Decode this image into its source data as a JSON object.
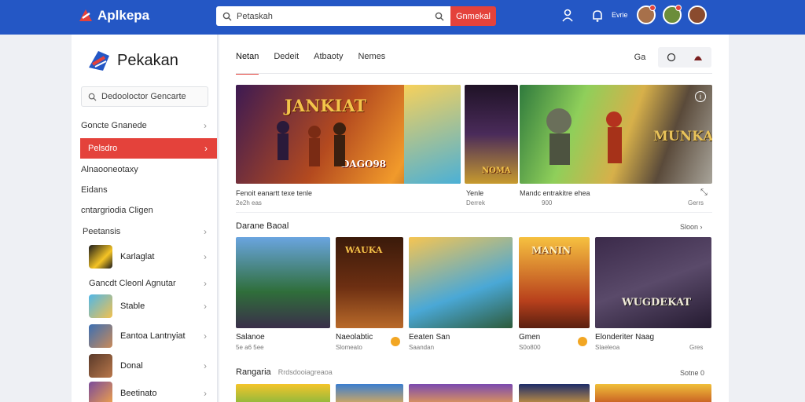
{
  "app": {
    "brand": "Aplkepa",
    "brand_color": "#2457c5",
    "accent_color": "#e4423b"
  },
  "header": {
    "search_placeholder": "Petaskah",
    "search_button": "Gnmekal",
    "label": "Evrie",
    "icons": [
      "user-icon",
      "notification-icon"
    ]
  },
  "sidebar": {
    "logo_text": "Pekakan",
    "search_placeholder": "Dedooloctor Gencarte",
    "items": [
      {
        "label": "Goncte Gnanede",
        "active": false
      },
      {
        "label": "Pelsdro",
        "active": true
      },
      {
        "label": "Alnaooneotaxy",
        "active": false
      },
      {
        "label": "Eidans",
        "active": false
      },
      {
        "label": "cntargriodia Cligen",
        "active": false
      },
      {
        "label": "Peetansis",
        "active": false
      }
    ],
    "games": [
      {
        "label": "Karlaglat"
      },
      {
        "label": "Stable"
      },
      {
        "label": "Eantoa Lantnyiat"
      },
      {
        "label": "Donal"
      },
      {
        "label": "Beetinato"
      }
    ],
    "group_label": "Gancdt Cleonl Agnutar"
  },
  "main": {
    "tabs": [
      "Netan",
      "Dedeit",
      "Atbaoty",
      "Nemes"
    ],
    "tool_label": "Ga",
    "banners": [
      {
        "art_title": "JANKIAT",
        "caption": "Fenoit eanartt texe tenle",
        "sub": "2e2h eas",
        "sub2": "",
        "badge": "DAGO98"
      },
      {
        "art_title": "NOMA",
        "caption": "Yenle",
        "sub": "Derrek",
        "sub2": "",
        "badge": ""
      },
      {
        "art_title": "MUNKA",
        "caption": "Mandc entrakitre ehea",
        "sub": "900",
        "sub2": "Gerrs",
        "badge": ""
      }
    ],
    "section1": {
      "title": "Darane Baoal",
      "more": "Sloon"
    },
    "cards": [
      {
        "title": "Salanoe",
        "sub": "5e a6 5ee"
      },
      {
        "title": "Naeolabtic",
        "sub": "Slomeato"
      },
      {
        "title": "Eeaten San",
        "sub": "Saandan"
      },
      {
        "title": "Gmen",
        "sub": "S0o800"
      },
      {
        "title": "Elonderiter Naag",
        "sub": "Slaeleoa"
      }
    ],
    "card_tail": "Gres",
    "card_art": [
      "WAUKA",
      "MANIN",
      "WUGDEKAT"
    ],
    "section2": {
      "title": "Rangaria",
      "subtitle": "Rrdsdooiagreaoa",
      "more": "Sotne 0"
    }
  }
}
